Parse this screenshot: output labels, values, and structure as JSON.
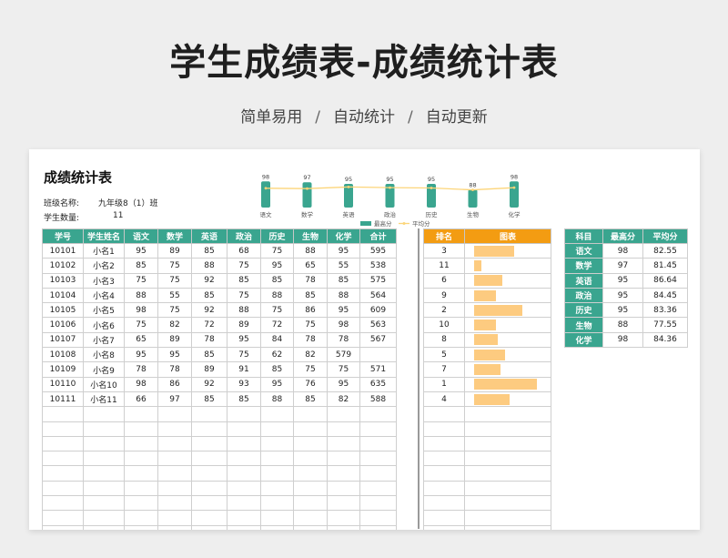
{
  "header": {
    "title": "学生成绩表-成绩统计表",
    "subtitle_parts": [
      "简单易用",
      "自动统计",
      "自动更新"
    ],
    "separator": "/"
  },
  "sheet": {
    "title": "成绩统计表",
    "class_label": "班级名称:",
    "class_value": "九年级8（1）班",
    "count_label": "学生数量:",
    "count_value": "11"
  },
  "colors": {
    "accent": "#3aa58f",
    "orange": "#f39c12",
    "bar": "#fdcb80",
    "line": "#fcd57a"
  },
  "scores": {
    "headers": [
      "学号",
      "学生姓名",
      "语文",
      "数学",
      "英语",
      "政治",
      "历史",
      "生物",
      "化学",
      "合计"
    ],
    "rows": [
      [
        "10101",
        "小名1",
        "95",
        "89",
        "85",
        "68",
        "75",
        "88",
        "95",
        "595"
      ],
      [
        "10102",
        "小名2",
        "85",
        "75",
        "88",
        "75",
        "95",
        "65",
        "55",
        "538"
      ],
      [
        "10103",
        "小名3",
        "75",
        "75",
        "92",
        "85",
        "85",
        "78",
        "85",
        "575"
      ],
      [
        "10104",
        "小名4",
        "88",
        "55",
        "85",
        "75",
        "88",
        "85",
        "88",
        "564"
      ],
      [
        "10105",
        "小名5",
        "98",
        "75",
        "92",
        "88",
        "75",
        "86",
        "95",
        "609"
      ],
      [
        "10106",
        "小名6",
        "75",
        "82",
        "72",
        "89",
        "72",
        "75",
        "98",
        "563"
      ],
      [
        "10107",
        "小名7",
        "65",
        "89",
        "78",
        "95",
        "84",
        "78",
        "78",
        "567"
      ],
      [
        "10108",
        "小名8",
        "95",
        "95",
        "85",
        "75",
        "62",
        "82",
        "579"
      ],
      [
        "10109",
        "小名9",
        "78",
        "78",
        "89",
        "91",
        "85",
        "75",
        "75",
        "571"
      ],
      [
        "10110",
        "小名10",
        "98",
        "86",
        "92",
        "93",
        "95",
        "76",
        "95",
        "635"
      ],
      [
        "10111",
        "小名11",
        "66",
        "97",
        "85",
        "85",
        "88",
        "85",
        "82",
        "588"
      ]
    ],
    "empty_rows": 9
  },
  "ranking": {
    "headers": [
      "排名",
      "图表"
    ],
    "ranks": [
      "3",
      "11",
      "6",
      "9",
      "2",
      "10",
      "8",
      "5",
      "7",
      "1",
      "4"
    ]
  },
  "subjects": {
    "headers": [
      "科目",
      "最高分",
      "平均分"
    ],
    "rows": [
      [
        "语文",
        "98",
        "82.55"
      ],
      [
        "数学",
        "97",
        "81.45"
      ],
      [
        "英语",
        "95",
        "86.64"
      ],
      [
        "政治",
        "95",
        "84.45"
      ],
      [
        "历史",
        "95",
        "83.36"
      ],
      [
        "生物",
        "88",
        "77.55"
      ],
      [
        "化学",
        "98",
        "84.36"
      ]
    ]
  },
  "chart_data": {
    "type": "bar",
    "categories": [
      "语文",
      "数学",
      "英语",
      "政治",
      "历史",
      "生物",
      "化学"
    ],
    "series": [
      {
        "name": "最高分",
        "type": "bar",
        "values": [
          98,
          97,
          95,
          95,
          95,
          88,
          98
        ]
      },
      {
        "name": "平均分",
        "type": "line",
        "values": [
          82.55,
          81.45,
          86.64,
          84.45,
          83.36,
          77.55,
          84.36
        ]
      }
    ],
    "ylim": [
      0,
      100
    ],
    "legend": "bottom",
    "grid": false
  }
}
